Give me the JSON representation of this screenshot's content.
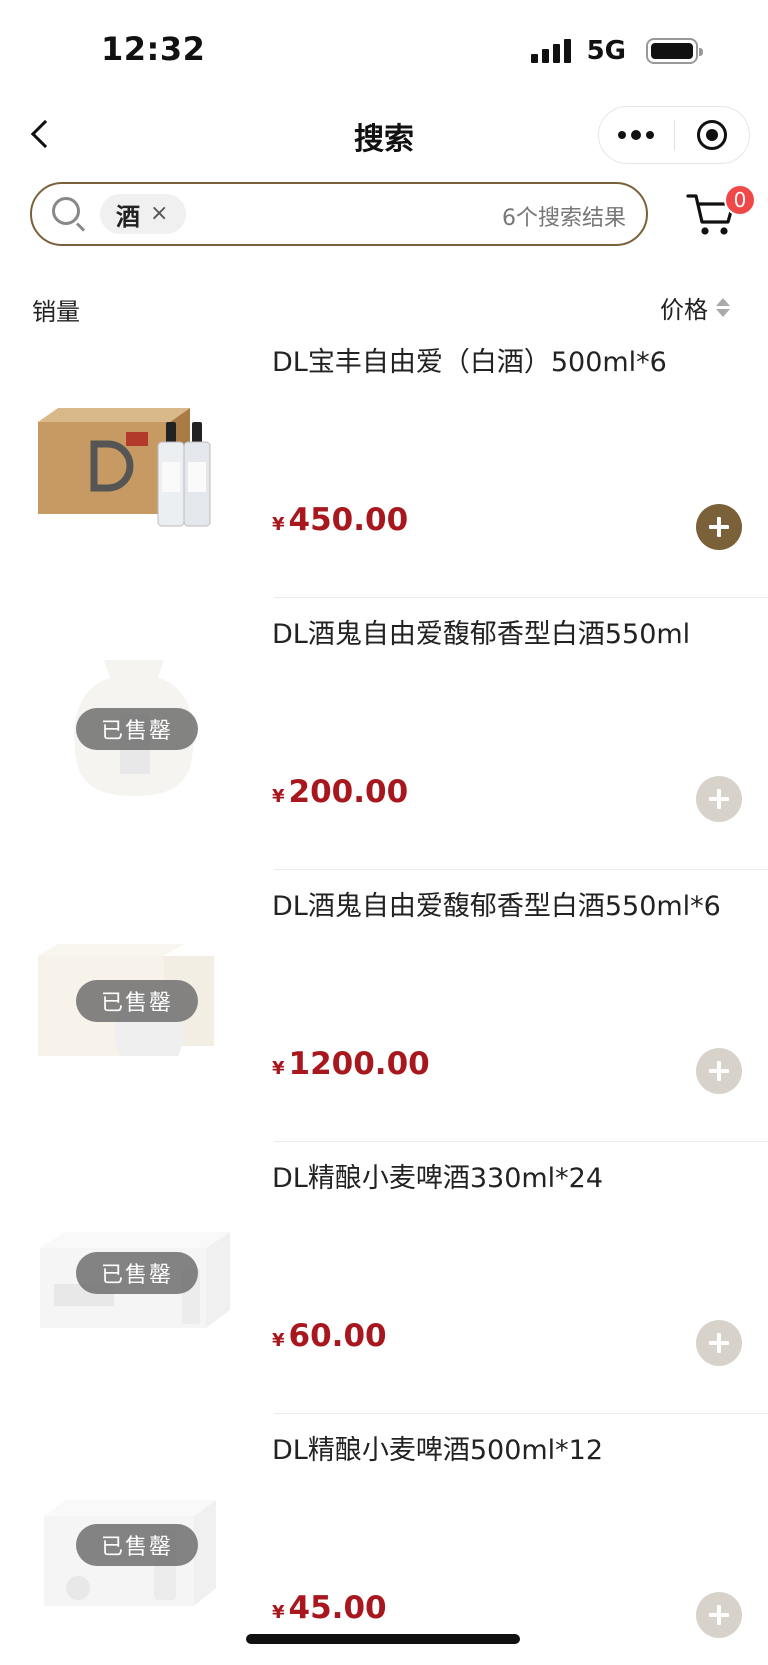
{
  "status_bar": {
    "time": "12:32",
    "network": "5G"
  },
  "nav": {
    "title": "搜索"
  },
  "search": {
    "tag": "酒",
    "tag_close": "×",
    "result_count": "6个搜索结果"
  },
  "cart": {
    "badge_count": "0"
  },
  "sort": {
    "sales_label": "销量",
    "price_label": "价格"
  },
  "colors": {
    "accent": "#7a6139",
    "price": "#a8171e",
    "badge": "#f04848",
    "disabled_add": "#d8d3ca"
  },
  "products": [
    {
      "name": "DL宝丰自由爱（白酒）500ml*6",
      "currency": "¥",
      "price": "450.00",
      "sold_out": false,
      "image_icon": "liquor-box-with-bottles"
    },
    {
      "name": "DL酒鬼自由爱馥郁香型白酒550ml",
      "currency": "¥",
      "price": "200.00",
      "sold_out": true,
      "soldout_label": "已售罄",
      "image_icon": "liquor-jar"
    },
    {
      "name": "DL酒鬼自由爱馥郁香型白酒550ml*6",
      "currency": "¥",
      "price": "1200.00",
      "sold_out": true,
      "soldout_label": "已售罄",
      "image_icon": "liquor-gift-box"
    },
    {
      "name": "DL精酿小麦啤酒330ml*24",
      "currency": "¥",
      "price": "60.00",
      "sold_out": true,
      "soldout_label": "已售罄",
      "image_icon": "beer-case"
    },
    {
      "name": "DL精酿小麦啤酒500ml*12",
      "currency": "¥",
      "price": "45.00",
      "sold_out": true,
      "soldout_label": "已售罄",
      "image_icon": "beer-case"
    }
  ]
}
